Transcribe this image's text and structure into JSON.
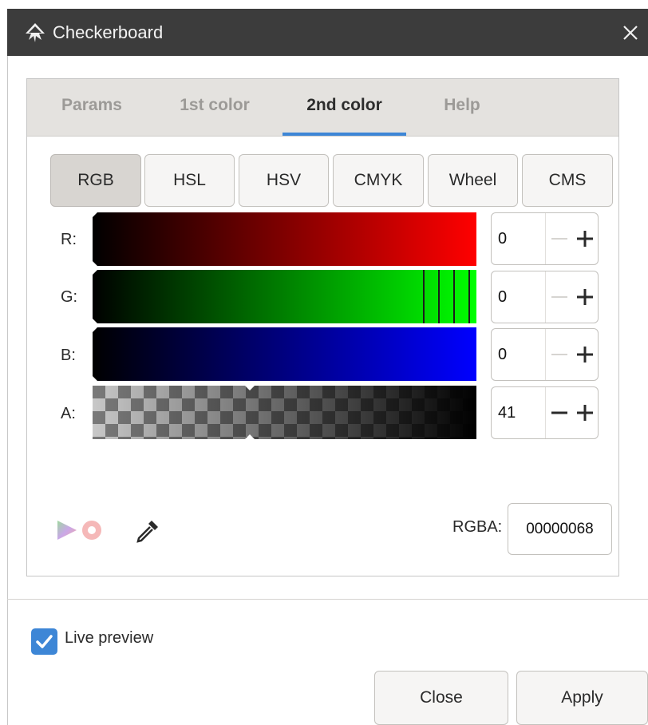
{
  "window": {
    "title": "Checkerboard",
    "icon": "inkscape-icon",
    "close_icon": "close-icon"
  },
  "tabs": [
    {
      "label": "Params",
      "active": false
    },
    {
      "label": "1st color",
      "active": false
    },
    {
      "label": "2nd color",
      "active": true
    },
    {
      "label": "Help",
      "active": false
    }
  ],
  "color_modes": [
    {
      "label": "RGB",
      "active": true
    },
    {
      "label": "HSL",
      "active": false
    },
    {
      "label": "HSV",
      "active": false
    },
    {
      "label": "CMYK",
      "active": false
    },
    {
      "label": "Wheel",
      "active": false
    },
    {
      "label": "CMS",
      "active": false
    }
  ],
  "channels": [
    {
      "label": "R:",
      "value": "0",
      "gradient_end": "#ff0000"
    },
    {
      "label": "G:",
      "value": "0",
      "gradient_end": "#00ff00"
    },
    {
      "label": "B:",
      "value": "0",
      "gradient_end": "#0000ff"
    },
    {
      "label": "A:",
      "value": "41",
      "gradient_end": "#000000"
    }
  ],
  "icons": {
    "gamut": "color-gamut-icon",
    "out_of_gamut": "out-of-gamut-icon",
    "picker": "eyedropper-icon"
  },
  "rgba": {
    "label": "RGBA:",
    "value": "00000068"
  },
  "live_preview": {
    "label": "Live preview",
    "checked": true
  },
  "buttons": {
    "close": "Close",
    "apply": "Apply"
  },
  "colors": {
    "accent": "#3d86d6",
    "titlebar": "#3c3c3c",
    "tab_bg": "#e4e2df"
  }
}
